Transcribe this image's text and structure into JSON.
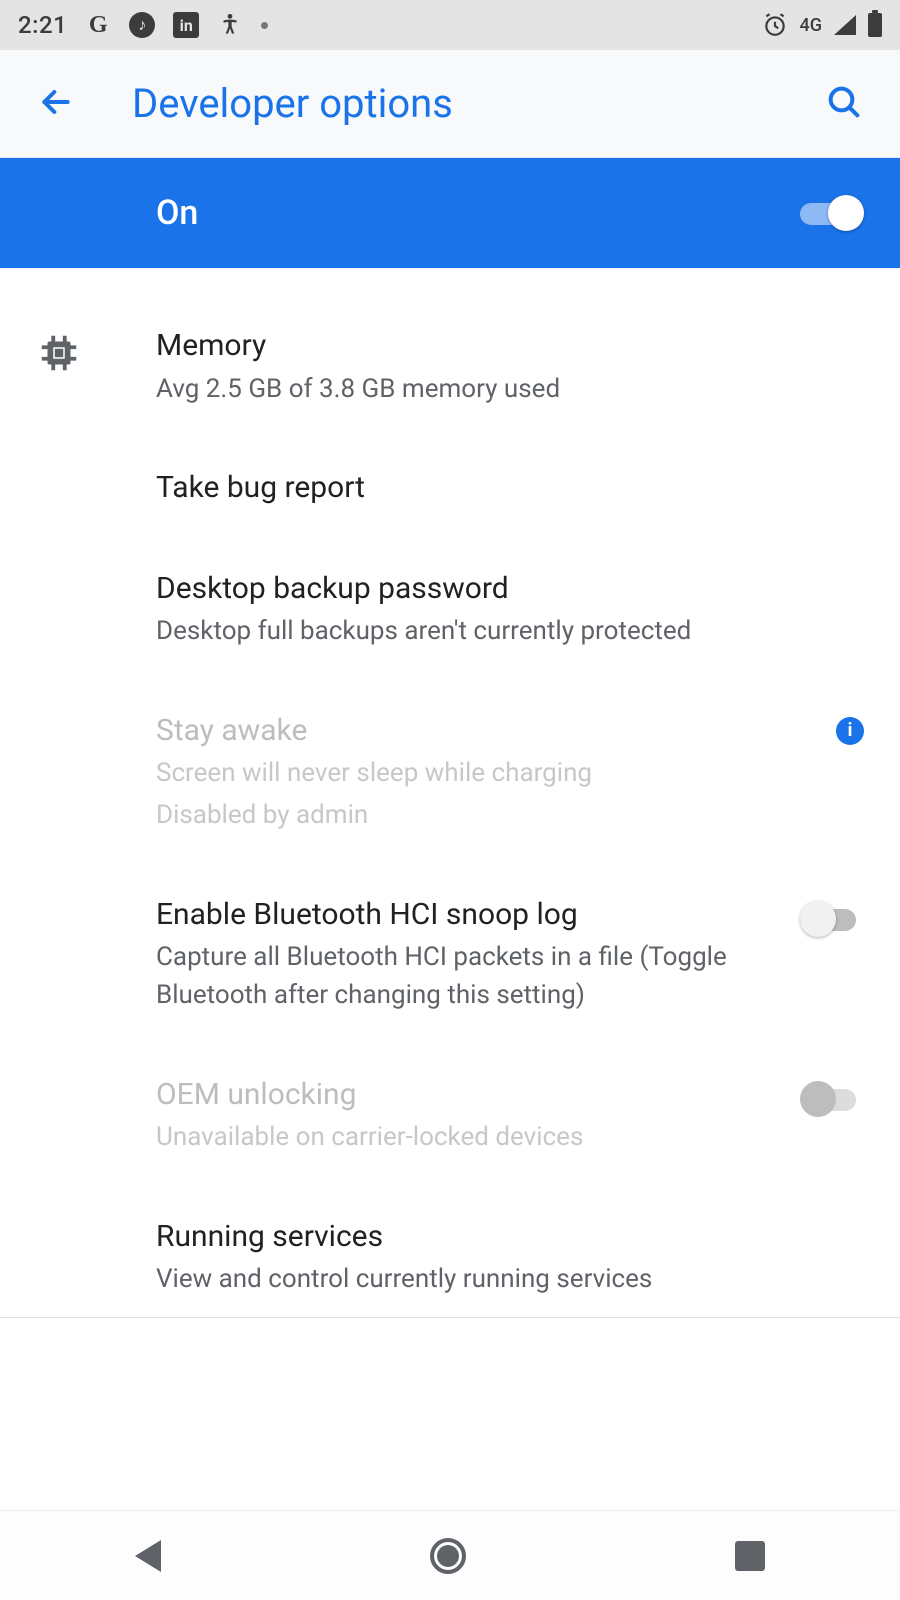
{
  "status": {
    "time": "2:21",
    "network": "4G"
  },
  "appbar": {
    "title": "Developer options"
  },
  "master": {
    "label": "On",
    "switch_on": true
  },
  "items": {
    "memory": {
      "title": "Memory",
      "sub": "Avg 2.5 GB of 3.8 GB memory used"
    },
    "bugreport": {
      "title": "Take bug report"
    },
    "desktop": {
      "title": "Desktop backup password",
      "sub": "Desktop full backups aren't currently protected"
    },
    "stayawake": {
      "title": "Stay awake",
      "sub1": "Screen will never sleep while charging",
      "sub2": "Disabled by admin"
    },
    "hci": {
      "title": "Enable Bluetooth HCI snoop log",
      "sub": "Capture all Bluetooth HCI packets in a file (Toggle Bluetooth after changing this setting)"
    },
    "oem": {
      "title": "OEM unlocking",
      "sub": "Unavailable on carrier-locked devices"
    },
    "running": {
      "title": "Running services",
      "sub": "View and control currently running services"
    }
  }
}
